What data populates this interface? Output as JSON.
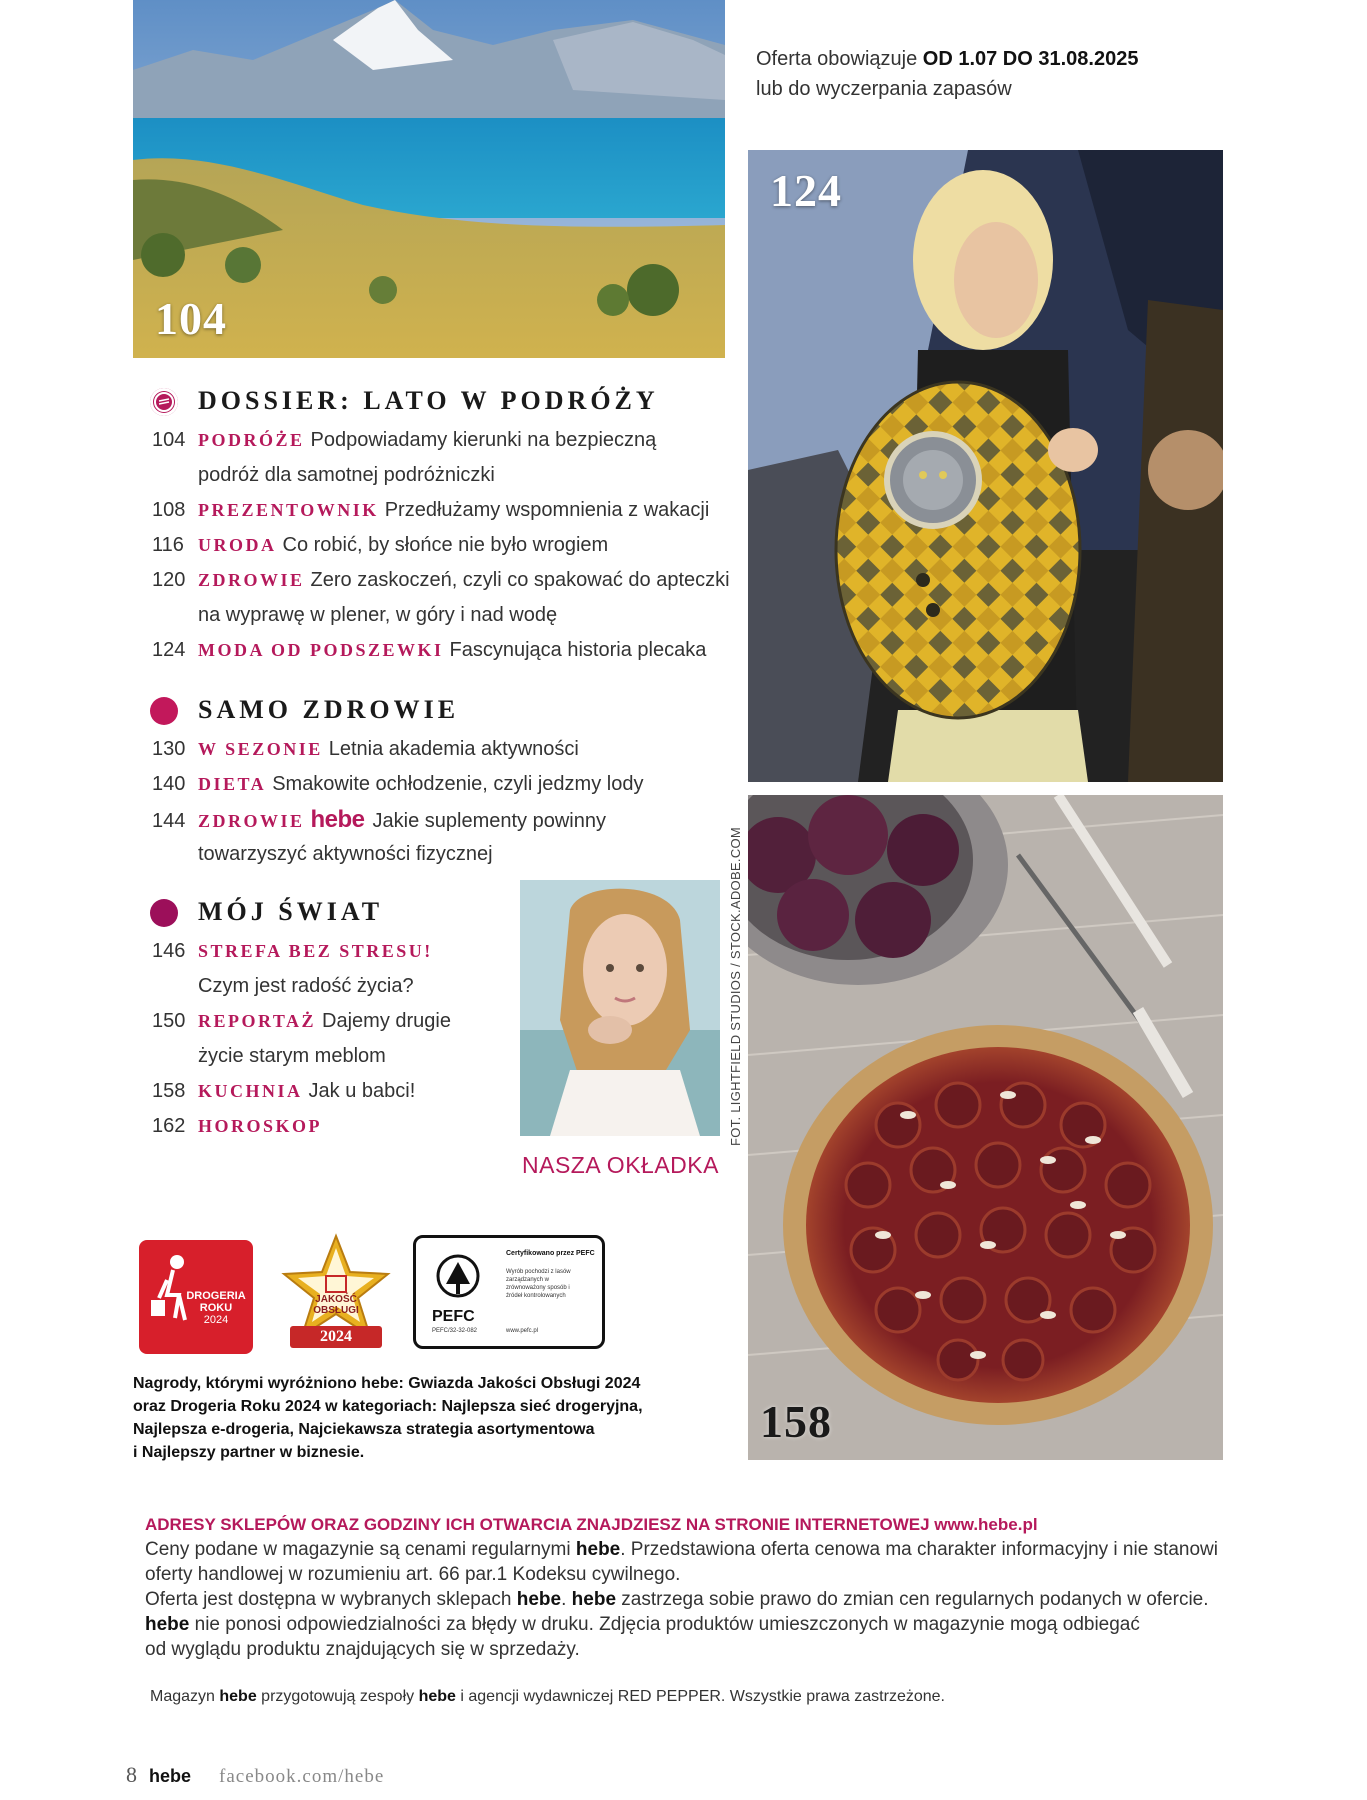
{
  "offer": {
    "line1_prefix": "Oferta obowiązuje ",
    "line1_bold": "OD 1.07 DO 31.08.2025",
    "line2": "lub do wyczerpania zapasów"
  },
  "photos": {
    "travel_num": "104",
    "fashion_num": "124",
    "food_num": "158"
  },
  "sections": [
    {
      "title": "DOSSIER: LATO W PODRÓŻY",
      "rows": [
        {
          "num": "104",
          "kw": "PODRÓŻE",
          "text": "Podpowiadamy kierunki na bezpieczną",
          "cont": "podróż dla samotnej podróżniczki"
        },
        {
          "num": "108",
          "kw": "PREZENTOWNIK",
          "text": "Przedłużamy wspomnienia z wakacji"
        },
        {
          "num": "116",
          "kw": "URODA",
          "text": "Co robić, by słońce nie było wrogiem"
        },
        {
          "num": "120",
          "kw": "ZDROWIE",
          "text": "Zero zaskoczeń, czyli co spakować do apteczki",
          "cont": "na wyprawę w plener, w góry i nad wodę"
        },
        {
          "num": "124",
          "kw": "MODA OD PODSZEWKI",
          "text": "Fascynująca historia plecaka"
        }
      ]
    },
    {
      "title": "SAMO ZDROWIE",
      "rows": [
        {
          "num": "130",
          "kw": "W SEZONIE",
          "text": "Letnia akademia aktywności"
        },
        {
          "num": "140",
          "kw": "DIETA",
          "text": "Smakowite ochłodzenie, czyli jedzmy lody"
        },
        {
          "num": "144",
          "kw": "ZDROWIE",
          "brand": "hebe",
          "text": "Jakie suplementy powinny",
          "cont": "towarzyszyć aktywności fizycznej"
        }
      ]
    },
    {
      "title": "MÓJ ŚWIAT",
      "rows": [
        {
          "num": "146",
          "kw": "STREFA BEZ STRESU!",
          "text": "",
          "cont": "Czym jest radość życia?"
        },
        {
          "num": "150",
          "kw": "REPORTAŻ",
          "text": "Dajemy drugie",
          "cont": "życie starym meblom"
        },
        {
          "num": "158",
          "kw": "KUCHNIA",
          "text": "Jak u babci!"
        },
        {
          "num": "162",
          "kw": "HOROSKOP",
          "text": ""
        }
      ]
    }
  ],
  "cover_label": "NASZA OKŁADKA",
  "photo_credit": "FOT. LIGHTFIELD STUDIOS / STOCK.ADOBE.COM",
  "badges": {
    "drogeria": {
      "line1": "DROGERIA",
      "line2": "ROKU",
      "line3": "2024"
    },
    "jakosc": {
      "line1": "JAKOŚĆ",
      "line2": "OBSŁUGI",
      "year": "2024"
    },
    "pefc": {
      "title": "Certyfikowano przez PEFC",
      "desc": "Wyrób pochodzi z lasów zarządzanych w zrównoważony sposób i źródeł kontrolowanych",
      "name": "PEFC",
      "code": "PEFC/32-32-082",
      "url": "www.pefc.pl"
    }
  },
  "awards_text": [
    "Nagrody, którymi wyróżniono hebe: Gwiazda Jakości Obsługi 2024",
    "oraz Drogeria Roku 2024 w kategoriach: Najlepsza sieć drogeryjna,",
    "Najlepsza e-drogeria, Najciekawsza strategia asortymentowa",
    "i Najlepszy partner w biznesie."
  ],
  "notice": {
    "head": "ADRESY SKLEPÓW ORAZ GODZINY ICH OTWARCIA ZNAJDZIESZ NA STRONIE INTERNETOWEJ www.hebe.pl",
    "p1a": "Ceny podane w magazynie są cenami regularnymi ",
    "brand": "hebe",
    "p1b": ". Przedstawiona oferta cenowa ma charakter informacyjny i nie stanowi",
    "p2": "oferty handlowej w rozumieniu art. 66 par.1 Kodeksu cywilnego.",
    "p3a": "Oferta jest dostępna w wybranych sklepach ",
    "p3b": ". ",
    "p3c": " zastrzega sobie prawo do zmian cen regularnych podanych w ofercie.",
    "p4": " nie ponosi odpowiedzialności za błędy w druku. Zdjęcia produktów umieszczonych w magazynie mogą odbiegać",
    "p5": "od wyglądu produktu znajdujących się w sprzedaży."
  },
  "footnote": {
    "a": "Magazyn ",
    "brand": "hebe",
    "b": " przygotowują zespoły ",
    "c": " i agencji wydawniczej RED PEPPER. Wszystkie prawa zastrzeżone."
  },
  "footer": {
    "page": "8",
    "brand": "hebe",
    "facebook": "facebook.com/hebe"
  },
  "colors": {
    "accent": "#b5195b",
    "section_dot_1": "#b5195b",
    "section_dot_2": "#c2185b",
    "section_dot_3": "#9c0f5a",
    "badge_red": "#d71f2b",
    "badge_gold": "#e8b020"
  }
}
